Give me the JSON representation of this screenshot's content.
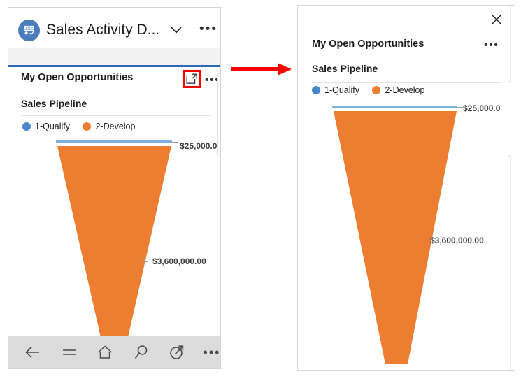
{
  "app": {
    "logo_icon": "dynamics-sales-grid-icon",
    "title": "Sales Activity D...",
    "chevron_icon": "chevron-down-icon",
    "overflow_icon": "ellipsis-icon",
    "overflow_label": "•••",
    "accent_color": "#2c6bb3"
  },
  "card": {
    "title": "My Open Opportunities",
    "expand_icon": "expand-chart-icon",
    "overflow_label": "•••",
    "highlight_color": "#ff0000"
  },
  "chart_header": {
    "title": "Sales Pipeline"
  },
  "legend": [
    {
      "label": "1-Qualify",
      "color": "#4a86c8"
    },
    {
      "label": "2-Develop",
      "color": "#ed7d31"
    }
  ],
  "labels": {
    "qualify_value_truncated": "$25,000.0",
    "develop_value": "$3,600,000.00"
  },
  "bottom_nav": [
    {
      "name": "back-icon",
      "label": "Back"
    },
    {
      "name": "hamburger-menu-icon",
      "label": "Menu"
    },
    {
      "name": "home-icon",
      "label": "Home"
    },
    {
      "name": "search-icon",
      "label": "Search"
    },
    {
      "name": "relationship-assistant-icon",
      "label": "Assistant"
    },
    {
      "name": "ellipsis-icon",
      "label": "•••"
    }
  ],
  "arrow": {
    "name": "red-pointer-arrow",
    "color": "#ff0000"
  },
  "expanded": {
    "close_label": "Close",
    "card_title": "My Open Opportunities",
    "overflow_label": "•••",
    "chart_title": "Sales Pipeline"
  },
  "chart_data": {
    "type": "funnel",
    "title": "Sales Pipeline",
    "categories": [
      "1-Qualify",
      "2-Develop"
    ],
    "values": [
      25000.0,
      3600000.0
    ],
    "value_labels": [
      "$25,000.0",
      "$3,600,000.00"
    ],
    "colors": [
      "#4a86c8",
      "#ed7d31"
    ],
    "legend_position": "top",
    "grid": false,
    "xlabel": "",
    "ylabel": ""
  }
}
